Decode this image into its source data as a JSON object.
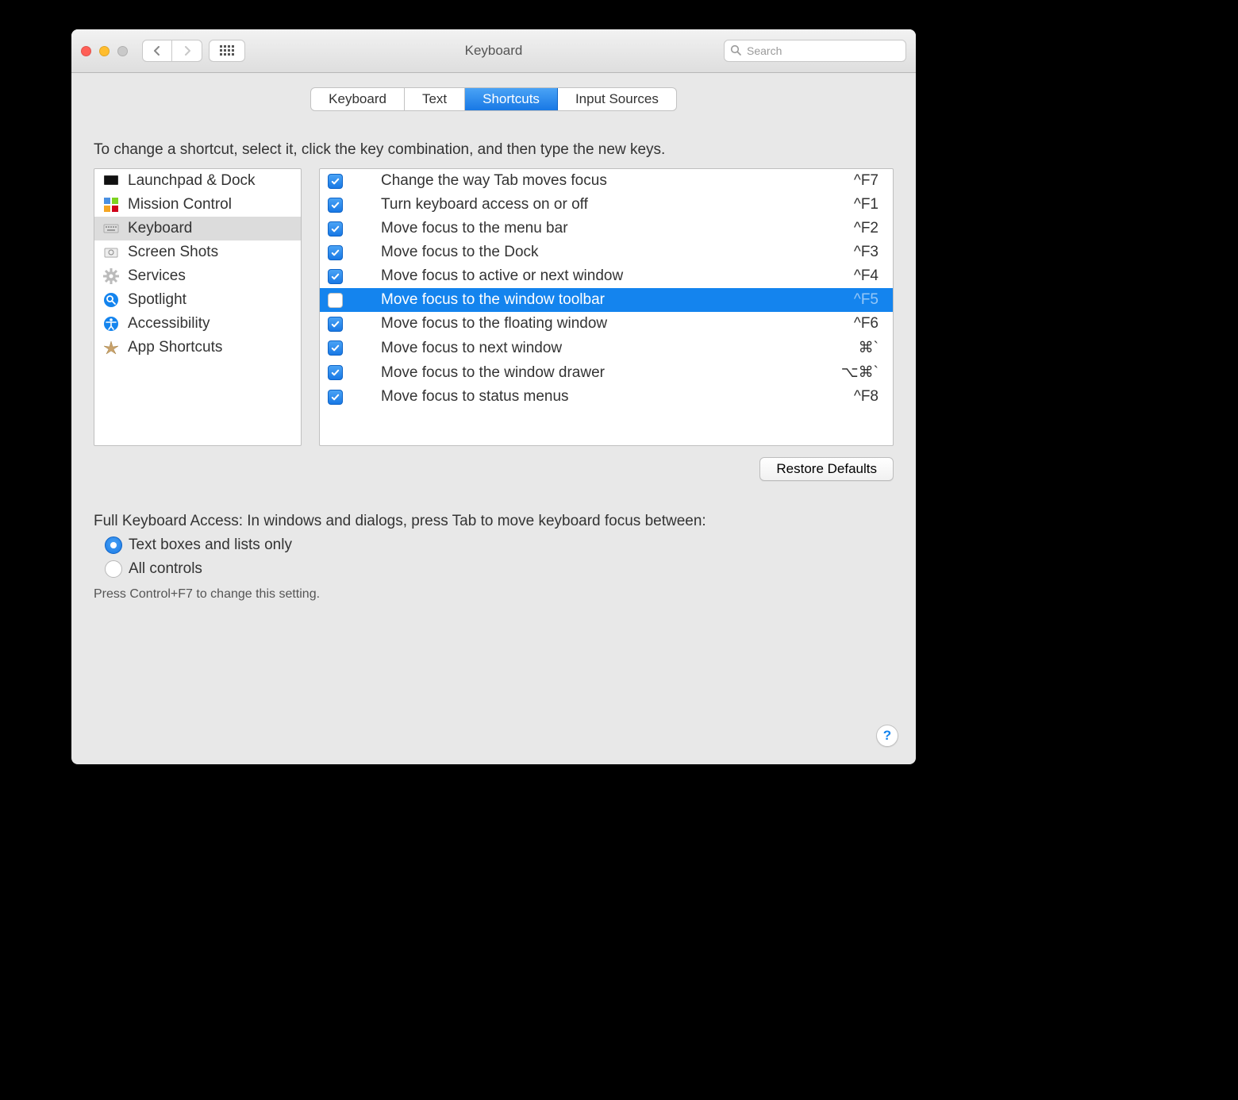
{
  "window": {
    "title": "Keyboard"
  },
  "search": {
    "placeholder": "Search"
  },
  "tabs": [
    {
      "label": "Keyboard",
      "active": false
    },
    {
      "label": "Text",
      "active": false
    },
    {
      "label": "Shortcuts",
      "active": true
    },
    {
      "label": "Input Sources",
      "active": false
    }
  ],
  "instruction": "To change a shortcut, select it, click the key combination, and then type the new keys.",
  "categories": [
    {
      "label": "Launchpad & Dock",
      "icon": "launchpad",
      "selected": false
    },
    {
      "label": "Mission Control",
      "icon": "mission-control",
      "selected": false
    },
    {
      "label": "Keyboard",
      "icon": "keyboard",
      "selected": true
    },
    {
      "label": "Screen Shots",
      "icon": "screenshot",
      "selected": false
    },
    {
      "label": "Services",
      "icon": "gear",
      "selected": false
    },
    {
      "label": "Spotlight",
      "icon": "spotlight",
      "selected": false
    },
    {
      "label": "Accessibility",
      "icon": "accessibility",
      "selected": false
    },
    {
      "label": "App Shortcuts",
      "icon": "app",
      "selected": false
    }
  ],
  "shortcuts": [
    {
      "checked": true,
      "label": "Change the way Tab moves focus",
      "keys": "^F7",
      "selected": false
    },
    {
      "checked": true,
      "label": "Turn keyboard access on or off",
      "keys": "^F1",
      "selected": false
    },
    {
      "checked": true,
      "label": "Move focus to the menu bar",
      "keys": "^F2",
      "selected": false
    },
    {
      "checked": true,
      "label": "Move focus to the Dock",
      "keys": "^F3",
      "selected": false
    },
    {
      "checked": true,
      "label": "Move focus to active or next window",
      "keys": "^F4",
      "selected": false
    },
    {
      "checked": false,
      "label": "Move focus to the window toolbar",
      "keys": "^F5",
      "selected": true
    },
    {
      "checked": true,
      "label": "Move focus to the floating window",
      "keys": "^F6",
      "selected": false
    },
    {
      "checked": true,
      "label": "Move focus to next window",
      "keys": "⌘`",
      "selected": false
    },
    {
      "checked": true,
      "label": "Move focus to the window drawer",
      "keys": "⌥⌘`",
      "selected": false
    },
    {
      "checked": true,
      "label": "Move focus to status menus",
      "keys": "^F8",
      "selected": false
    }
  ],
  "restore_defaults": "Restore Defaults",
  "fka": {
    "title": "Full Keyboard Access: In windows and dialogs, press Tab to move keyboard focus between:",
    "option1": "Text boxes and lists only",
    "option2": "All controls",
    "selected": 0,
    "hint": "Press Control+F7 to change this setting."
  },
  "help": "?"
}
